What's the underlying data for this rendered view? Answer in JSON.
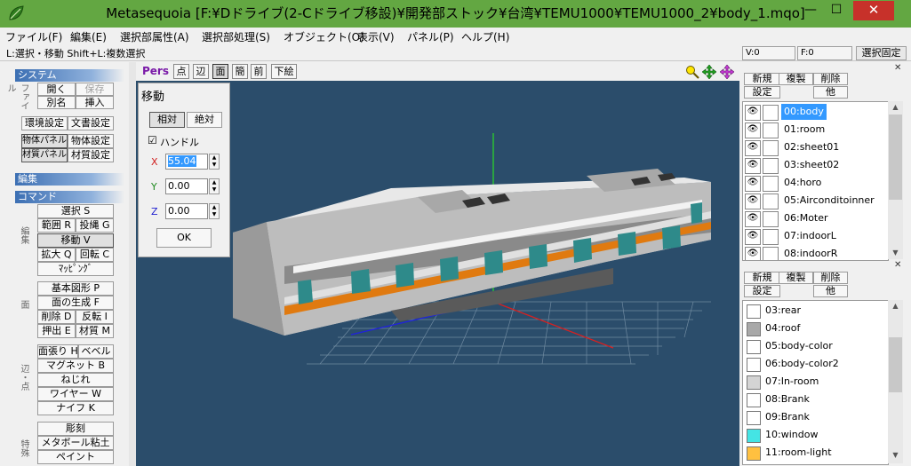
{
  "window": {
    "title": "Metasequoia [F:¥Dドライブ(2-Cドライブ移設)¥開発部ストック¥台湾¥TEMU1000¥TEMU1000_2¥body_1.mqo]",
    "minimize": "—",
    "maximize": "☐",
    "close": "✕"
  },
  "menu": [
    "ファイル(F)",
    "編集(E)",
    "選択部属性(A)",
    "選択部処理(S)",
    "オブジェクト(O)",
    "表示(V)",
    "パネル(P)",
    "ヘルプ(H)"
  ],
  "status": {
    "hint": "L:選択・移動  Shift+L:複数選択",
    "vertex": "V:0",
    "face": "F:0",
    "select_fixed": "選択固定"
  },
  "left": {
    "system_header": "システム",
    "file_label": "ファイル",
    "open": "開く",
    "save": "保存",
    "save_as": "別名",
    "insert": "挿入",
    "env_settings": "環境設定",
    "doc_settings": "文書設定",
    "obj_panel": "物体パネル",
    "obj_settings": "物体設定",
    "mat_panel": "材質パネル",
    "mat_settings": "材質設定",
    "edit_header": "編集",
    "command_header": "コマンド",
    "edit_label": "編集",
    "select": "選択 S",
    "range": "範囲 R",
    "lasso": "投縄 G",
    "move": "移動 V",
    "scale": "拡大 Q",
    "rotate": "回転 C",
    "mapping": "ﾏｯﾋﾟﾝｸﾞ",
    "face_label": "面",
    "basic_shape": "基本図形 P",
    "face_gen": "面の生成 F",
    "delete": "削除 D",
    "flip": "反転 I",
    "extrude": "押出 E",
    "material": "材質 M",
    "edge_label": "辺・点",
    "face_stretch": "面張り H",
    "bevel": "ベベル",
    "magnet": "マグネット B",
    "twist": "ねじれ",
    "wire": "ワイヤー W",
    "knife": "ナイフ K",
    "special_label": "特殊",
    "carve": "彫刻",
    "metaball": "メタボール粘土",
    "paint": "ペイント"
  },
  "view_toolbar": {
    "pers": "Pers",
    "point": "点",
    "edge": "辺",
    "face": "面",
    "simple": "簡",
    "front": "前",
    "sketch": "下絵"
  },
  "move_dialog": {
    "title": "移動",
    "relative": "相対",
    "absolute": "絶対",
    "handle_check": "☑",
    "handle": "ハンドル",
    "x_label": "X",
    "y_label": "Y",
    "z_label": "Z",
    "x": "55.04",
    "y": "0.00",
    "z": "0.00",
    "ok": "OK"
  },
  "object_panel": {
    "new": "新規",
    "duplicate": "複製",
    "delete": "削除",
    "settings": "設定",
    "other": "他",
    "items": [
      "00:body",
      "01:room",
      "02:sheet01",
      "03:sheet02",
      "04:horo",
      "05:Airconditoinner",
      "06:Moter",
      "07:indoorL",
      "08:indoorR"
    ],
    "selected": "00:body"
  },
  "material_panel": {
    "new": "新規",
    "duplicate": "複製",
    "delete": "削除",
    "settings": "設定",
    "other": "他",
    "items": [
      {
        "name": "03:rear",
        "color": "#ffffff"
      },
      {
        "name": "04:roof",
        "color": "#a8a8a8"
      },
      {
        "name": "05:body-color",
        "color": "#ffffff"
      },
      {
        "name": "06:body-color2",
        "color": "#ffffff"
      },
      {
        "name": "07:In-room",
        "color": "#d4d4d4"
      },
      {
        "name": "08:Brank",
        "color": "#ffffff"
      },
      {
        "name": "09:Brank",
        "color": "#ffffff"
      },
      {
        "name": "10:window",
        "color": "#44e4e4"
      },
      {
        "name": "11:room-light",
        "color": "#ffc040"
      }
    ]
  },
  "colors": {
    "title_bar": "#63a742",
    "viewport_bg": "#2b4d6b",
    "selection": "#3399ff",
    "close_button": "#c7312a"
  }
}
